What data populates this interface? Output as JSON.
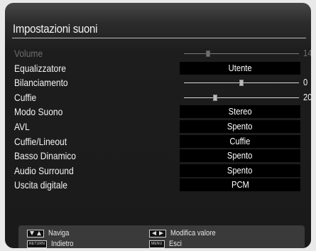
{
  "title": "Impostazioni suoni",
  "rows": [
    {
      "label": "Volume",
      "type": "slider",
      "value": "14",
      "level": 0.21,
      "dim": true
    },
    {
      "label": "Equalizzatore",
      "type": "select",
      "value": "Utente"
    },
    {
      "label": "Bilanciamento",
      "type": "slider",
      "value": "0",
      "level": 0.5
    },
    {
      "label": "Cuffie",
      "type": "slider",
      "value": "20",
      "level": 0.27
    },
    {
      "label": "Modo Suono",
      "type": "select",
      "value": "Stereo"
    },
    {
      "label": "AVL",
      "type": "select",
      "value": "Spento"
    },
    {
      "label": "Cuffie/Lineout",
      "type": "select",
      "value": "Cuffie"
    },
    {
      "label": "Basso Dinamico",
      "type": "select",
      "value": "Spento"
    },
    {
      "label": "Audio Surround",
      "type": "select",
      "value": "Spento"
    },
    {
      "label": "Uscita digitale",
      "type": "select",
      "value": "PCM"
    }
  ],
  "footer": {
    "nav_label": "Naviga",
    "back_key": "RETURN",
    "back_label": "Indietro",
    "modify_label": "Modifica valore",
    "menu_key": "MENU",
    "exit_label": "Esci"
  }
}
